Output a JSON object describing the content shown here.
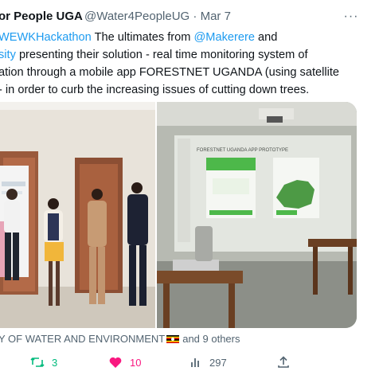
{
  "author": {
    "name": "or People UGA",
    "handle": "@Water4PeopleUG",
    "separator": "·",
    "date": "Mar 7"
  },
  "more_label": "···",
  "tweet": {
    "line1": {
      "hashtag": "WEWKHackathon",
      "text_a": " The ultimates from ",
      "mention": "@Makerere",
      "text_b": " and"
    },
    "line2": {
      "mention_tail": "sity",
      "text": " presenting their solution - real time monitoring system of"
    },
    "line3": "ation through a mobile app FORESTNET UGANDA (using satellite",
    "line4": "- in order to curb the increasing issues of cutting down trees."
  },
  "media": {
    "screen_title": "FORESTNET UGANDA APP PROTOTYPE"
  },
  "tagged": {
    "org": "Y OF WATER AND ENVIRONMENT",
    "rest": "and 9 others"
  },
  "actions": {
    "retweets": "3",
    "likes": "10",
    "views": "297"
  },
  "colors": {
    "link": "#1d9bf0",
    "retweet": "#00ba7c",
    "like": "#f91880",
    "muted": "#536471",
    "text": "#0f1419"
  },
  "icons": [
    "more-icon",
    "retweet-icon",
    "heart-icon",
    "views-icon",
    "share-icon",
    "uganda-flag-icon"
  ]
}
